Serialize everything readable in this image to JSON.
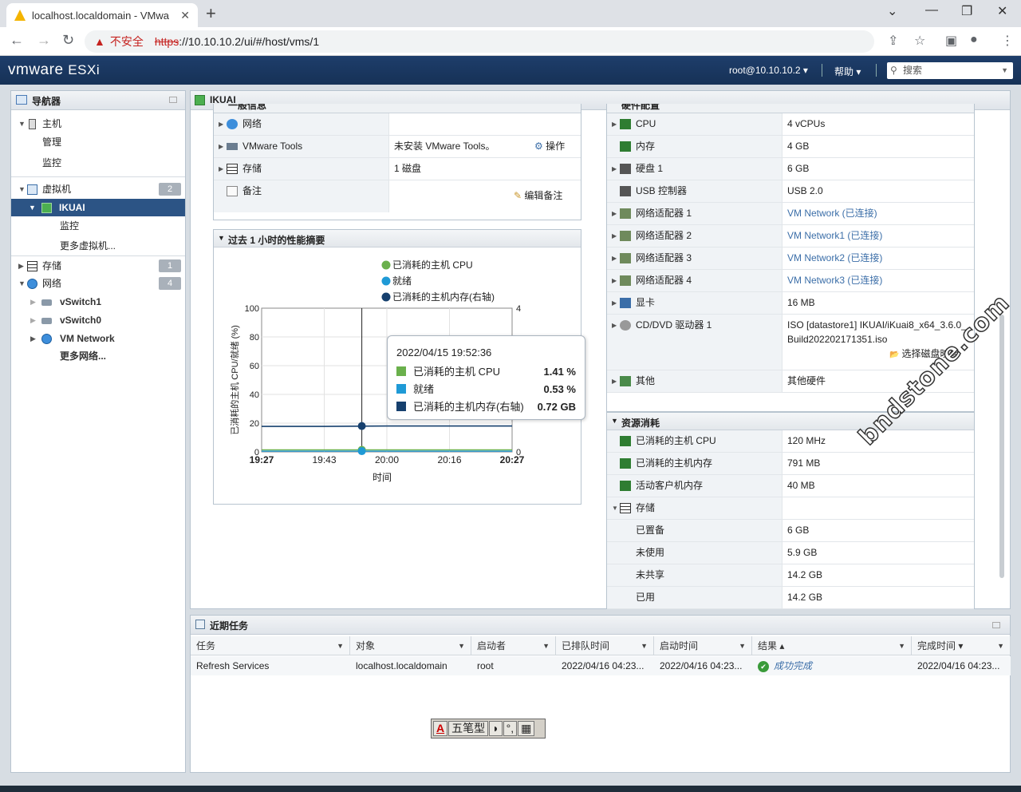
{
  "browser": {
    "tab_title": "localhost.localdomain - VMwa",
    "url_insecure": "不安全",
    "url_https": "https",
    "url_rest": "://10.10.10.2/ui/#/host/vms/1"
  },
  "header": {
    "logo_vm": "vm",
    "logo_ware": "ware",
    "logo_esxi": "ESXi",
    "user": "root@10.10.10.2 ▾",
    "help": "帮助 ▾",
    "search_placeholder": "搜索"
  },
  "navigator": {
    "title": "导航器",
    "host": "主机",
    "manage": "管理",
    "monitor": "监控",
    "vms": "虚拟机",
    "vms_count": "2",
    "vm_selected": "IKUAI",
    "vm_monitor": "监控",
    "more_vms": "更多虚拟机...",
    "storage": "存储",
    "storage_count": "1",
    "network": "网络",
    "network_count": "4",
    "vswitch1": "vSwitch1",
    "vswitch0": "vSwitch0",
    "vm_network": "VM Network",
    "more_networks": "更多网络..."
  },
  "content": {
    "title": "IKUAI",
    "general": {
      "title": "一般信息",
      "rows": [
        {
          "key": "网络",
          "value": ""
        },
        {
          "key": "VMware Tools",
          "value": "未安装 VMware Tools。",
          "action": "操作"
        },
        {
          "key": "存储",
          "value": "1 磁盘"
        },
        {
          "key": "备注",
          "value": "",
          "action": "编辑备注"
        }
      ]
    },
    "perf": {
      "title": "过去 1 小时的性能摘要",
      "legend": [
        "已消耗的主机 CPU",
        "就绪",
        "已消耗的主机内存(右轴)"
      ],
      "xlabel": "时间",
      "ylabel": "已消耗的主机 CPU/就绪 (%)",
      "tooltip": {
        "time": "2022/04/15 19:52:36",
        "rows": [
          {
            "label": "已消耗的主机 CPU",
            "value": "1.41 %"
          },
          {
            "label": "就绪",
            "value": "0.53 %"
          },
          {
            "label": "已消耗的主机内存(右轴)",
            "value": "0.72 GB"
          }
        ]
      }
    },
    "hardware": {
      "title": "硬件配置",
      "rows": [
        {
          "key": "CPU",
          "value": "4 vCPUs"
        },
        {
          "key": "内存",
          "value": "4 GB"
        },
        {
          "key": "硬盘 1",
          "value": "6 GB"
        },
        {
          "key": "USB 控制器",
          "value": "USB 2.0"
        },
        {
          "key": "网络适配器 1",
          "value": "VM Network (已连接)"
        },
        {
          "key": "网络适配器 2",
          "value": "VM Network1 (已连接)"
        },
        {
          "key": "网络适配器 3",
          "value": "VM Network2 (已连接)"
        },
        {
          "key": "网络适配器 4",
          "value": "VM Network3 (已连接)"
        },
        {
          "key": "显卡",
          "value": "16 MB"
        },
        {
          "key": "CD/DVD 驱动器 1",
          "value": "ISO [datastore1] IKUAI/iKuai8_x64_3.6.0_",
          "value2": "Build202202171351.iso",
          "action": "选择磁盘映像"
        },
        {
          "key": "其他",
          "value": "其他硬件"
        }
      ]
    },
    "resources": {
      "title": "资源消耗",
      "rows": [
        {
          "key": "已消耗的主机 CPU",
          "value": "120 MHz"
        },
        {
          "key": "已消耗的主机内存",
          "value": "791 MB"
        },
        {
          "key": "活动客户机内存",
          "value": "40 MB"
        },
        {
          "key": "存储",
          "value": ""
        },
        {
          "key": "已置备",
          "value": "6 GB"
        },
        {
          "key": "未使用",
          "value": "5.9 GB"
        },
        {
          "key": "未共享",
          "value": "14.2 GB"
        },
        {
          "key": "已用",
          "value": "14.2 GB"
        }
      ]
    }
  },
  "tasks": {
    "title": "近期任务",
    "columns": [
      "任务",
      "对象",
      "启动者",
      "已排队时间",
      "启动时间",
      "结果 ▴",
      "完成时间 ▾"
    ],
    "row": [
      "Refresh Services",
      "localhost.localdomain",
      "root",
      "2022/04/16 04:23...",
      "2022/04/16 04:23...",
      "成功完成",
      "2022/04/16 04:23..."
    ]
  },
  "ime": [
    "A",
    "五笔型",
    "◗",
    "°,",
    "▦"
  ],
  "watermark": "bndstone.com",
  "chart_data": {
    "type": "line",
    "legend": [
      "已消耗的主机 CPU",
      "就绪",
      "已消耗的主机内存(右轴)"
    ],
    "x": [
      "19:27",
      "19:43",
      "20:00",
      "20:16",
      "20:27"
    ],
    "xlabel": "时间",
    "ylabel": "已消耗的主机 CPU/就绪 (%)",
    "ylim": [
      0,
      100
    ],
    "y_ticks": [
      "0",
      "20",
      "40",
      "60",
      "80",
      "100"
    ],
    "y2lim": [
      0,
      4
    ],
    "y2_ticks": [
      "0",
      "1",
      "2",
      "3",
      "4"
    ],
    "series": [
      {
        "name": "已消耗的主机 CPU",
        "color": "#6ab04c",
        "axis": "left",
        "values": [
          1.4,
          1.4,
          1.41,
          1.4,
          1.4
        ]
      },
      {
        "name": "就绪",
        "color": "#1f9ad6",
        "axis": "left",
        "values": [
          0.5,
          0.5,
          0.53,
          0.5,
          0.5
        ]
      },
      {
        "name": "已消耗的主机内存(右轴)",
        "color": "#16406e",
        "axis": "right",
        "values": [
          0.71,
          0.71,
          0.72,
          0.72,
          0.72
        ]
      }
    ],
    "cursor_x": "19:52:36"
  }
}
